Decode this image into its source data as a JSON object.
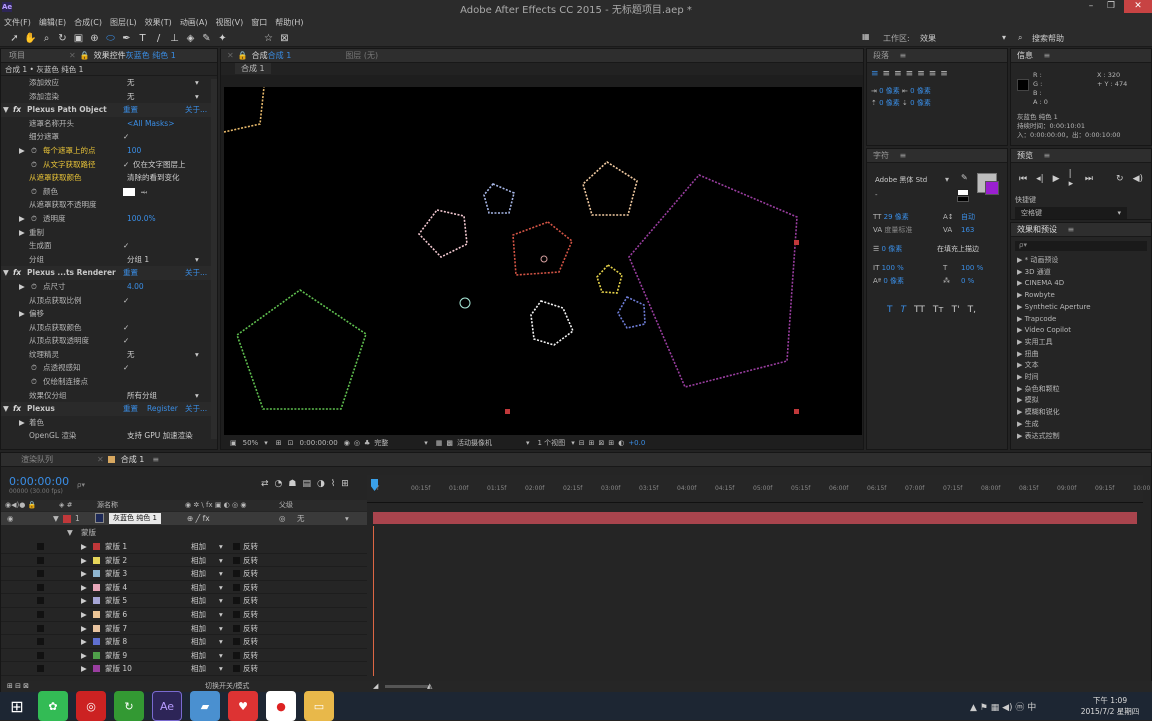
{
  "app": {
    "title": "Adobe After Effects CC 2015 - 无标题项目.aep *",
    "icon": "Ae"
  },
  "menu": [
    "文件(F)",
    "编辑(E)",
    "合成(C)",
    "图层(L)",
    "效果(T)",
    "动画(A)",
    "视图(V)",
    "窗口",
    "帮助(H)"
  ],
  "workspace": {
    "label": "工作区:",
    "value": "效果",
    "search": "搜索帮助"
  },
  "project_tabs": {
    "project": "项目",
    "effects": "效果控件 ",
    "effects_layer": "灰蓝色 纯色 1"
  },
  "effect_header": "合成 1 • 灰蓝色 纯色 1",
  "effects": [
    {
      "label": "添加效应",
      "value": "无",
      "dropdown": true
    },
    {
      "label": "添加渲染",
      "value": "无",
      "dropdown": true
    },
    {
      "label": "Plexus Path Object",
      "fx": true,
      "reset": "重置",
      "about": "关于..."
    },
    {
      "label": "遮罩名称开头",
      "value": "<All Masks>",
      "valcls": "blue"
    },
    {
      "label": "细分遮罩",
      "check": true
    },
    {
      "label": "每个遮罩上的点",
      "value": "100",
      "valcls": "blue",
      "stopwatch": true,
      "lblcls": "yellow",
      "twirl": true
    },
    {
      "label": "从文字获取路径",
      "value": "仅在文字图层上",
      "check": true,
      "lblcls": "yellow",
      "stopwatch": true
    },
    {
      "label": "从遮罩获取颜色",
      "value": "清除的看到变化",
      "lblcls": "yellow"
    },
    {
      "label": "颜色",
      "stopwatch": true,
      "swatch": true
    },
    {
      "label": "从遮罩获取不透明度"
    },
    {
      "label": "透明度",
      "value": "100.0%",
      "valcls": "blue",
      "stopwatch": true,
      "twirl": true
    },
    {
      "label": "重制",
      "twirl": true
    },
    {
      "label": "生成面",
      "check": true
    },
    {
      "label": "分组",
      "value": "分组 1",
      "dropdown": true
    },
    {
      "label": "Plexus ...ts Renderer",
      "fx": true,
      "reset": "重置",
      "about": "关于..."
    },
    {
      "label": "点尺寸",
      "value": "4.00",
      "valcls": "blue",
      "stopwatch": true,
      "twirl": true
    },
    {
      "label": "从顶点获取比例",
      "check": true
    },
    {
      "label": "偏移",
      "twirl": true
    },
    {
      "label": "从顶点获取颜色",
      "check": true
    },
    {
      "label": "从顶点获取透明度",
      "check": true
    },
    {
      "label": "纹理精灵",
      "value": "无",
      "dropdown": true
    },
    {
      "label": "点透视感知",
      "check": true,
      "stopwatch": true
    },
    {
      "label": "仅绘制连接点",
      "stopwatch": true
    },
    {
      "label": "效果仅分组",
      "value": "所有分组",
      "dropdown": true
    },
    {
      "label": "Plexus",
      "fx": true,
      "reset": "重置",
      "register": "Register",
      "about": "关于..."
    },
    {
      "label": "着色",
      "twirl": true
    },
    {
      "label": "OpenGL 渲染",
      "value": "支持 GPU 加速渲染"
    }
  ],
  "viewer": {
    "tab": "合成 ",
    "tab_name": "合成 1",
    "layer_tab": "图层  (无)",
    "sub": "合成 1",
    "zoom": "50%",
    "timecode": "0:00:00:00",
    "quality": "完整",
    "camera": "活动摄像机",
    "views": "1 个视图",
    "exposure": "+0.0"
  },
  "paragraph": {
    "title": "段落",
    "px": "0 像素"
  },
  "character": {
    "title": "字符",
    "font": "Adobe 黑体 Std",
    "style": "-",
    "size": "29 像素",
    "leading": "自动",
    "kerning": "度量标准",
    "tracking": "163",
    "stroke": "0 像素",
    "stroke_mode": "在填充上描边",
    "vscale": "100 %",
    "hscale": "100 %",
    "baseline": "0 像素",
    "tsume": "0 %"
  },
  "info": {
    "title": "信息",
    "r": "R :",
    "g": "G :",
    "b": "B :",
    "a": "A : 0",
    "x": "X : 320",
    "y": "+ Y : 474",
    "layer": "灰蓝色 纯色 1",
    "duration": "持续时间：0:00:10:01",
    "inout": "入：0:00:00:00，出：0:00:10:00"
  },
  "preview": {
    "title": "预览",
    "shortcut_label": "快捷键",
    "shortcut": "空格键"
  },
  "effects_presets": {
    "title": "效果和预设",
    "search_ph": "ρ▾",
    "items": [
      "* 动画预设",
      "3D 通道",
      "CINEMA 4D",
      "Rowbyte",
      "Synthetic Aperture",
      "Trapcode",
      "Video Copilot",
      "实用工具",
      "扭曲",
      "文本",
      "时间",
      "杂色和颗粒",
      "模拟",
      "模糊和锐化",
      "生成",
      "表达式控制"
    ]
  },
  "timeline": {
    "render_tab": "渲染队列",
    "comp_tab": "合成 1",
    "time": "0:00:00:00",
    "fps": "00000 (30.00 fps)",
    "search_ph": "ρ▾",
    "col_source": "源名称",
    "col_parent": "父级",
    "layer_num": "1",
    "layer_name": "灰蓝色 纯色 1",
    "parent": "无",
    "masks_label": "蒙版",
    "mode": "相加",
    "invert": "反转",
    "bottom": "切换开关/模式",
    "ruler": [
      "0f",
      "00:15f",
      "01:00f",
      "01:15f",
      "02:00f",
      "02:15f",
      "03:00f",
      "03:15f",
      "04:00f",
      "04:15f",
      "05:00f",
      "05:15f",
      "06:00f",
      "06:15f",
      "07:00f",
      "07:15f",
      "08:00f",
      "08:15f",
      "09:00f",
      "09:15f",
      "10:00"
    ],
    "masks": [
      {
        "name": "蒙版 1",
        "color": "#c0383a"
      },
      {
        "name": "蒙版 2",
        "color": "#e6d65a"
      },
      {
        "name": "蒙版 3",
        "color": "#8fb5d0"
      },
      {
        "name": "蒙版 4",
        "color": "#e6a6b8"
      },
      {
        "name": "蒙版 5",
        "color": "#a6a6d6"
      },
      {
        "name": "蒙版 6",
        "color": "#ecc596"
      },
      {
        "name": "蒙版 7",
        "color": "#e8c4a0"
      },
      {
        "name": "蒙版 8",
        "color": "#5f6fd0"
      },
      {
        "name": "蒙版 9",
        "color": "#4fa04a"
      },
      {
        "name": "蒙版 10",
        "color": "#9a3ea0"
      }
    ]
  },
  "taskbar": {
    "time": "下午 1:09",
    "date": "2015/7/2 星期四"
  }
}
